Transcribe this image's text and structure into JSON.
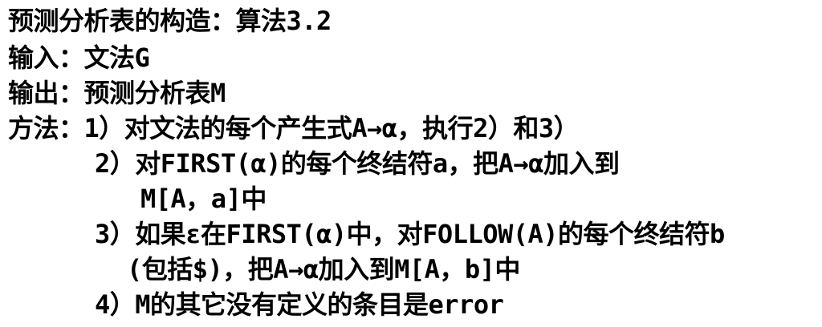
{
  "document": {
    "lines": [
      "预测分析表的构造：算法3.2",
      "输入：文法G",
      "输出：预测分析表M",
      "方法：1）对文法的每个产生式A→α，执行2）和3）",
      "2）对FIRST(α)的每个终结符a，把A→α加入到",
      "M[A，a]中",
      "3）如果ε在FIRST(α)中，对FOLLOW(A)的每个终结符b",
      "(包括$)，把A→α加入到M[A，b]中",
      "4）M的其它没有定义的条目是error"
    ]
  }
}
